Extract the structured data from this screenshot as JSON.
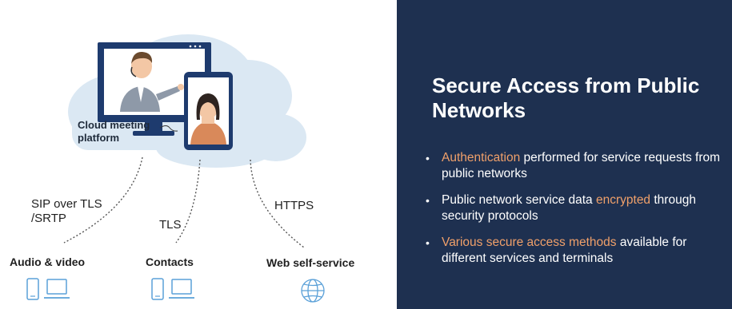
{
  "diagram": {
    "cloud_label_line1": "Cloud meeting",
    "cloud_label_line2": "platform",
    "links": [
      {
        "line1": "SIP over TLS",
        "line2": "/SRTP"
      },
      {
        "line1": "TLS"
      },
      {
        "line1": "HTTPS"
      }
    ],
    "endpoints": [
      {
        "label": "Audio & video",
        "icons": [
          "phone-icon",
          "laptop-icon"
        ]
      },
      {
        "label": "Contacts",
        "icons": [
          "phone-icon",
          "laptop-icon"
        ]
      },
      {
        "label": "Web self-service",
        "icons": [
          "globe-icon"
        ]
      }
    ],
    "colors": {
      "cloud": "#dbe8f3",
      "monitor": "#1e3b6e",
      "screen": "#ffffff",
      "dotted_line": "#555555",
      "icon": "#5aa0d8"
    }
  },
  "panel": {
    "title": "Secure Access from Public Networks",
    "background": "#1e3050",
    "highlight_color": "#f0a06a",
    "bullets": [
      {
        "highlight": "Authentication",
        "rest": " performed for service requests from public networks"
      },
      {
        "pre": "Public network service data ",
        "highlight": "encrypted",
        "rest": " through security protocols"
      },
      {
        "highlight": "Various secure access methods",
        "rest": " available for different services and terminals"
      }
    ]
  }
}
